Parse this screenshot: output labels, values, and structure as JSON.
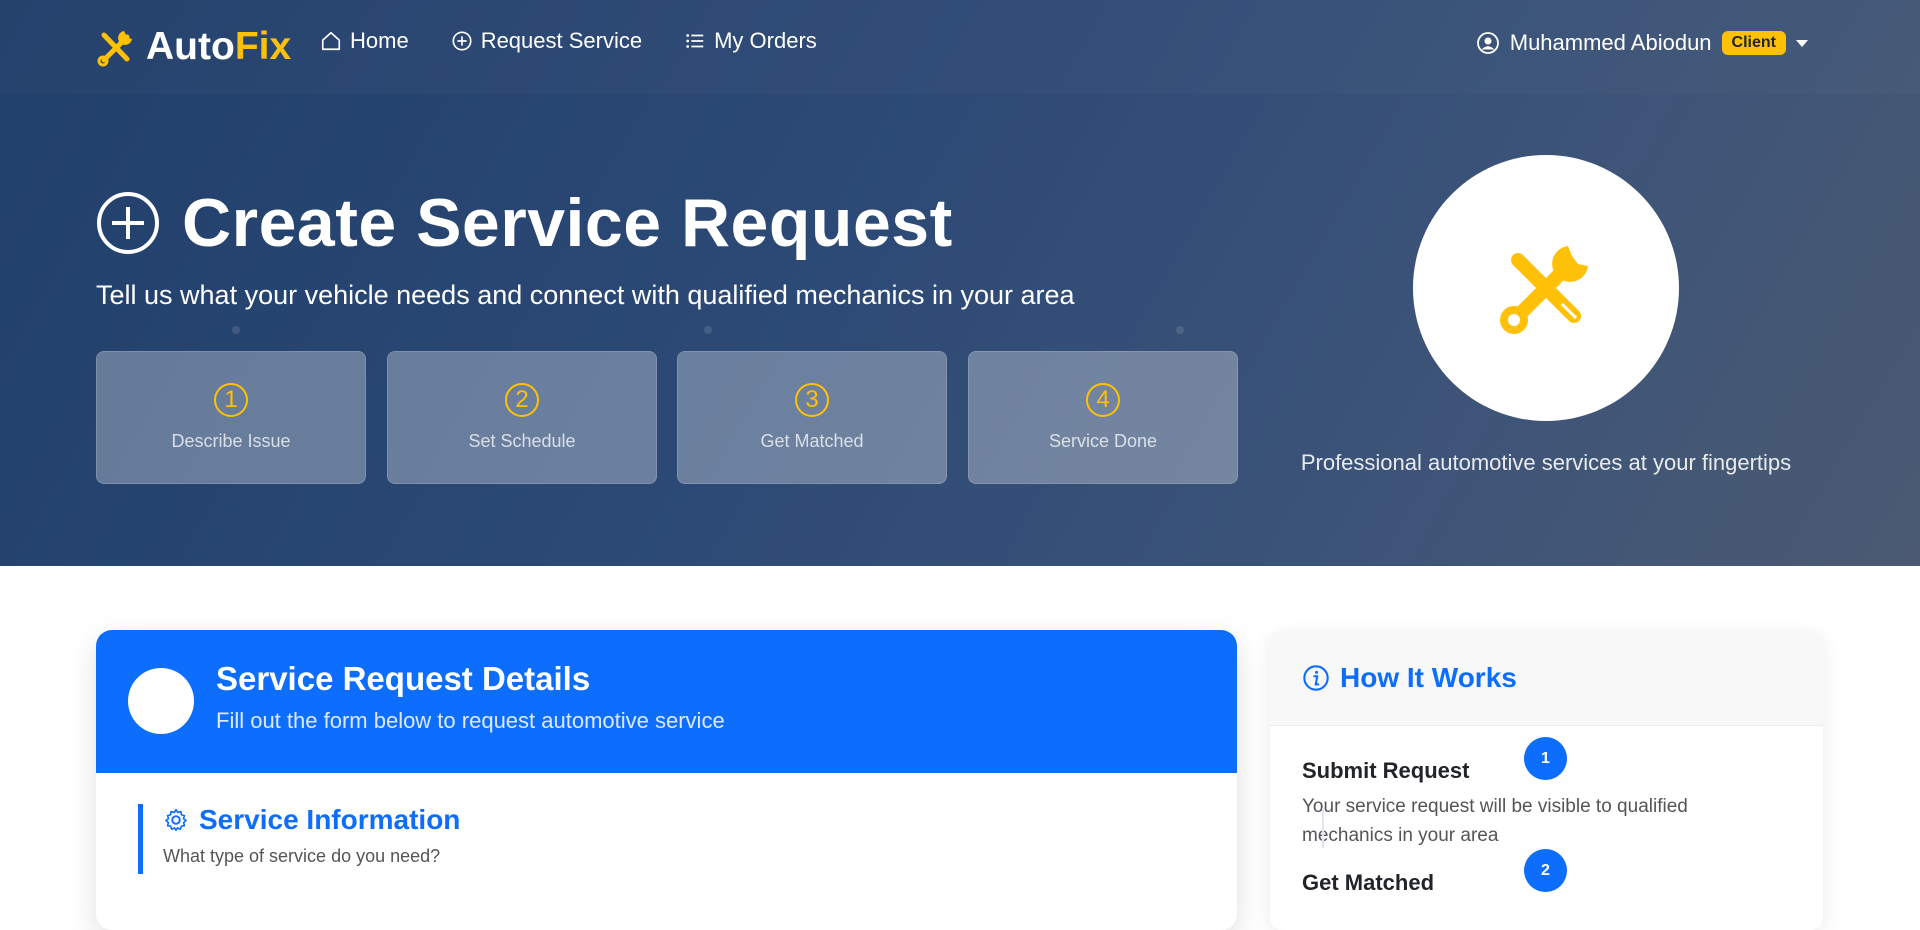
{
  "nav": {
    "brand_part1": "Auto",
    "brand_part2": "Fix",
    "links": [
      {
        "label": "Home",
        "icon": "home-icon"
      },
      {
        "label": "Request Service",
        "icon": "plus-circle-icon"
      },
      {
        "label": "My Orders",
        "icon": "list-icon"
      }
    ],
    "user_name": "Muhammed Abiodun",
    "user_role": "Client"
  },
  "hero": {
    "title": "Create Service Request",
    "subtitle": "Tell us what your vehicle needs and connect with qualified mechanics in your area",
    "steps": [
      {
        "number": "1",
        "label": "Describe Issue"
      },
      {
        "number": "2",
        "label": "Set Schedule"
      },
      {
        "number": "3",
        "label": "Get Matched"
      },
      {
        "number": "4",
        "label": "Service Done"
      }
    ],
    "tagline": "Professional automotive services at your fingertips"
  },
  "form_card": {
    "title": "Service Request Details",
    "subtitle": "Fill out the form below to request automotive service",
    "section_title": "Service Information",
    "section_subtitle": "What type of service do you need?"
  },
  "how_it_works": {
    "title": "How It Works",
    "steps": [
      {
        "number": "1",
        "title": "Submit Request",
        "description": "Your service request will be visible to qualified mechanics in your area"
      },
      {
        "number": "2",
        "title": "Get Matched",
        "description": ""
      }
    ]
  },
  "colors": {
    "primary": "#0d6efd",
    "accent": "#ffc107",
    "hero_bg": "#2d4a76"
  }
}
